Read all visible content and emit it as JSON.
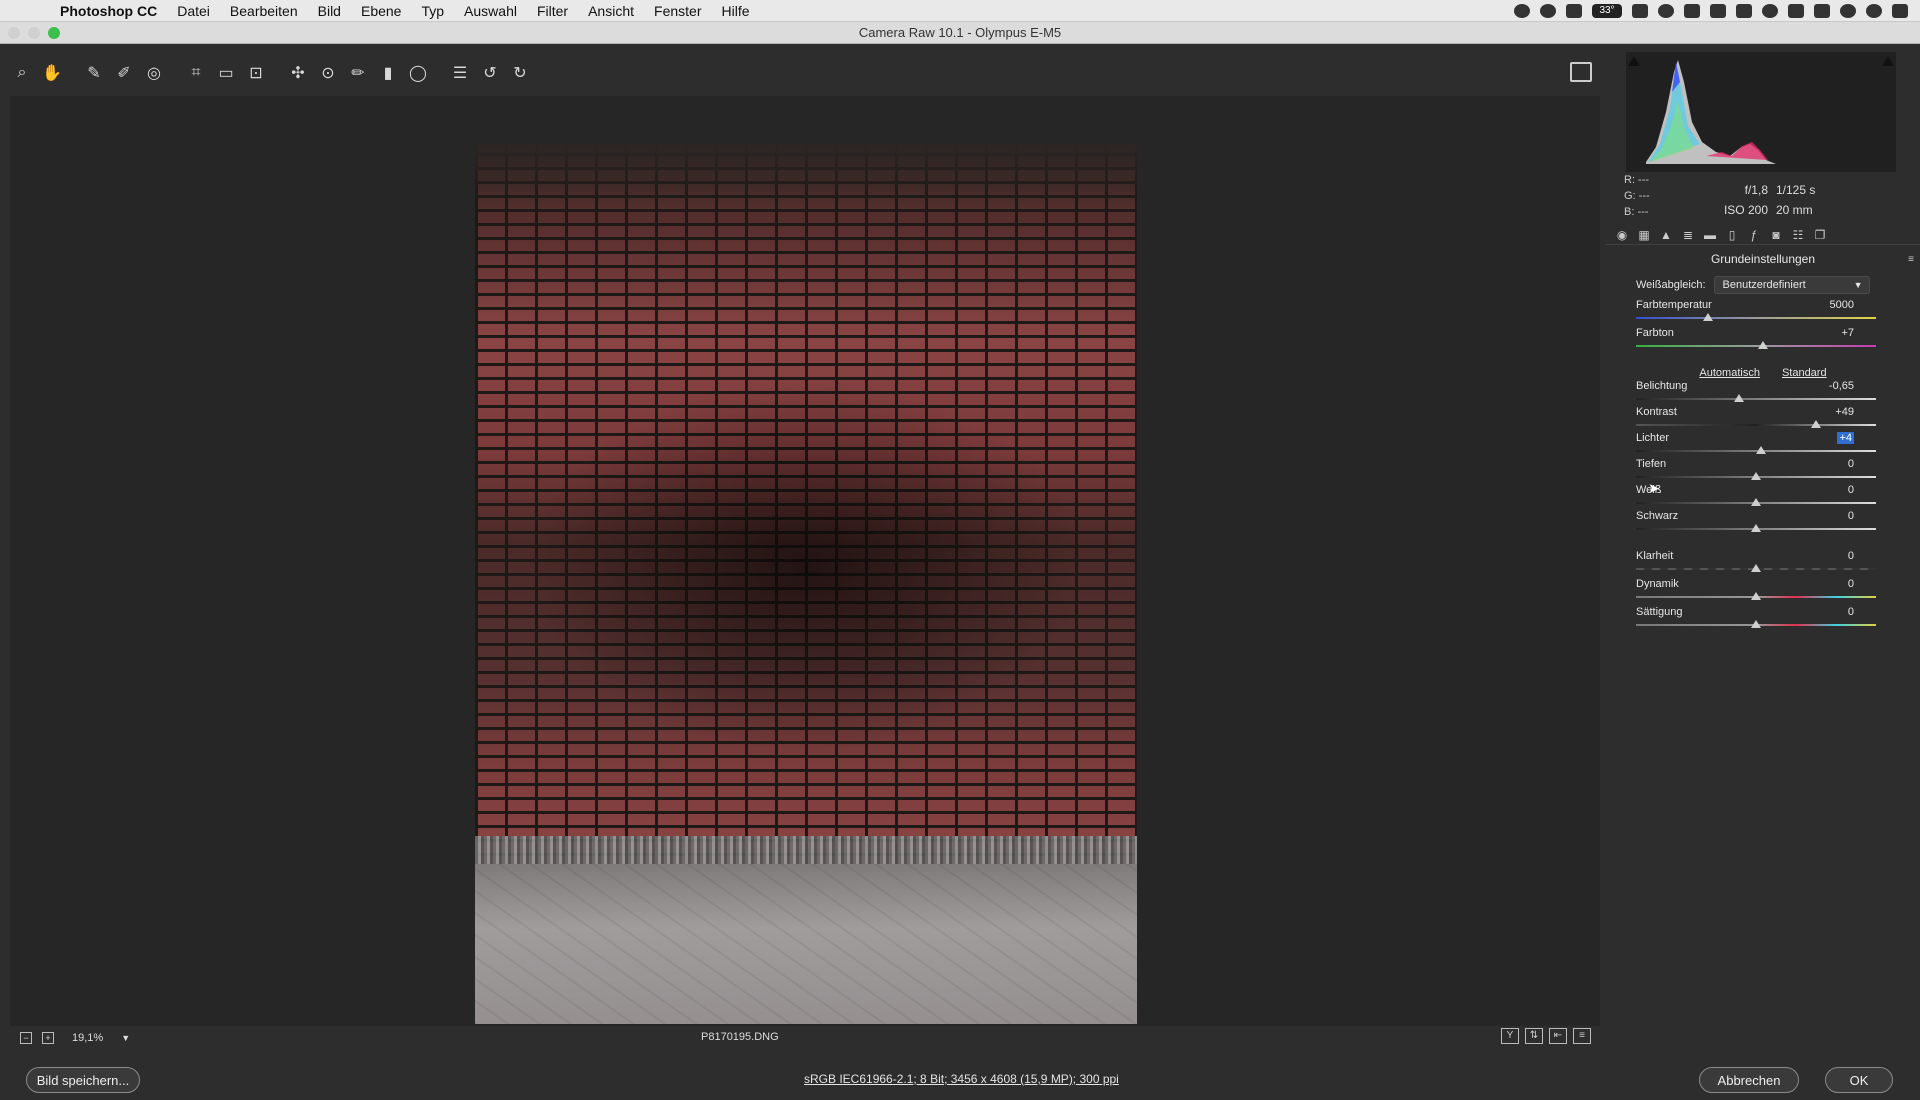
{
  "menubar": {
    "app": "Photoshop CC",
    "items": [
      "Datei",
      "Bearbeiten",
      "Bild",
      "Ebene",
      "Typ",
      "Auswahl",
      "Filter",
      "Ansicht",
      "Fenster",
      "Hilfe"
    ],
    "temp": "33°"
  },
  "window": {
    "title": "Camera Raw 10.1  -  Olympus E-M5"
  },
  "status_strip": {
    "zoom": "19,1%",
    "filename": "P8170195.DNG"
  },
  "bottom": {
    "save": "Bild speichern...",
    "workflow": "sRGB IEC61966-2.1; 8 Bit; 3456 x 4608 (15,9 MP); 300 ppi",
    "cancel": "Abbrechen",
    "ok": "OK"
  },
  "readout": {
    "r": "R:    ---",
    "g": "G:    ---",
    "b": "B:    ---"
  },
  "exif": {
    "aperture": "f/1,8",
    "shutter": "1/125 s",
    "iso": "ISO 200",
    "focal": "20 mm"
  },
  "panel": {
    "title": "Grundeinstellungen",
    "wb_label": "Weißabgleich:",
    "wb_value": "Benutzerdefiniert",
    "auto": "Automatisch",
    "standard": "Standard",
    "sliders": [
      {
        "label": "Farbtemperatur",
        "value": "5000",
        "pos": 0.3
      },
      {
        "label": "Farbton",
        "value": "+7",
        "pos": 0.53
      },
      {
        "label": "Belichtung",
        "value": "-0,65",
        "pos": 0.43
      },
      {
        "label": "Kontrast",
        "value": "+49",
        "pos": 0.75
      },
      {
        "label": "Lichter",
        "value": "+4",
        "pos": 0.52
      },
      {
        "label": "Tiefen",
        "value": "0",
        "pos": 0.5
      },
      {
        "label": "Weiß",
        "value": "0",
        "pos": 0.5
      },
      {
        "label": "Schwarz",
        "value": "0",
        "pos": 0.5
      },
      {
        "label": "Klarheit",
        "value": "0",
        "pos": 0.5
      },
      {
        "label": "Dynamik",
        "value": "0",
        "pos": 0.5
      },
      {
        "label": "Sättigung",
        "value": "0",
        "pos": 0.5
      }
    ]
  },
  "colors": {
    "selected_value": "#2f6fd1",
    "background": "#2d2d2d"
  }
}
